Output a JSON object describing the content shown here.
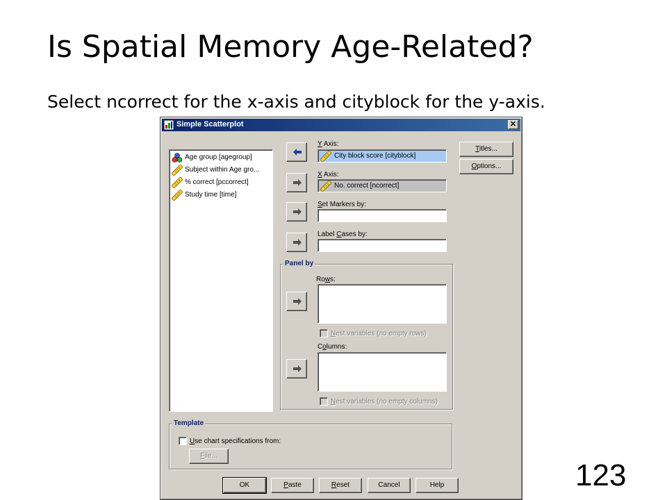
{
  "slide": {
    "title": "Is Spatial Memory Age-Related?",
    "body": "Select ncorrect for the x-axis and cityblock for the y-axis.",
    "page_number": "123"
  },
  "dialog": {
    "title": "Simple Scatterplot",
    "close_glyph": "✕",
    "variables": [
      {
        "label": "Age group [agegroup]",
        "icon": "nominal-variable-icon"
      },
      {
        "label": "Subject within Age gro...",
        "icon": "scale-variable-icon"
      },
      {
        "label": "% correct [pccorrect]",
        "icon": "scale-variable-icon"
      },
      {
        "label": "Study time [time]",
        "icon": "scale-variable-icon"
      }
    ],
    "y_axis": {
      "label_u": "Y",
      "label_rest": " Axis:",
      "value": "City block score [cityblock]"
    },
    "x_axis": {
      "label_u": "X",
      "label_rest": " Axis:",
      "value": "No. correct [ncorrect]"
    },
    "set_markers": {
      "label_u": "S",
      "label_rest": "et Markers by:"
    },
    "label_cases": {
      "label_pre": "Label ",
      "label_u": "C",
      "label_rest": "ases by:"
    },
    "panel_by": {
      "title": "Panel by",
      "rows_label_pre": "Ro",
      "rows_label_u": "w",
      "rows_label_rest": "s:",
      "nest_rows_u": "N",
      "nest_rows_rest": "est variables (no empty rows)",
      "columns_label_pre": "C",
      "columns_label_u": "o",
      "columns_label_rest": "lumns:",
      "nest_cols_u": "N",
      "nest_cols_rest": "est variables (no empty columns)"
    },
    "template": {
      "title": "Template",
      "checkbox_u": "U",
      "checkbox_rest": "se chart specifications from:",
      "file_u": "F",
      "file_rest": "ile..."
    },
    "side_buttons": {
      "titles_u": "T",
      "titles_rest": "itles...",
      "options_u": "O",
      "options_rest": "ptions..."
    },
    "bottom_buttons": {
      "ok": "OK",
      "paste_u": "P",
      "paste_rest": "aste",
      "reset_u": "R",
      "reset_rest": "eset",
      "cancel": "Cancel",
      "help": "Help"
    }
  },
  "colors": {
    "titlebar_start": "#0a246a",
    "titlebar_end": "#3a6ea5",
    "dialog_face": "#d4d0c8",
    "selected_target": "#a6caf0",
    "group_title": "#0a246a"
  }
}
